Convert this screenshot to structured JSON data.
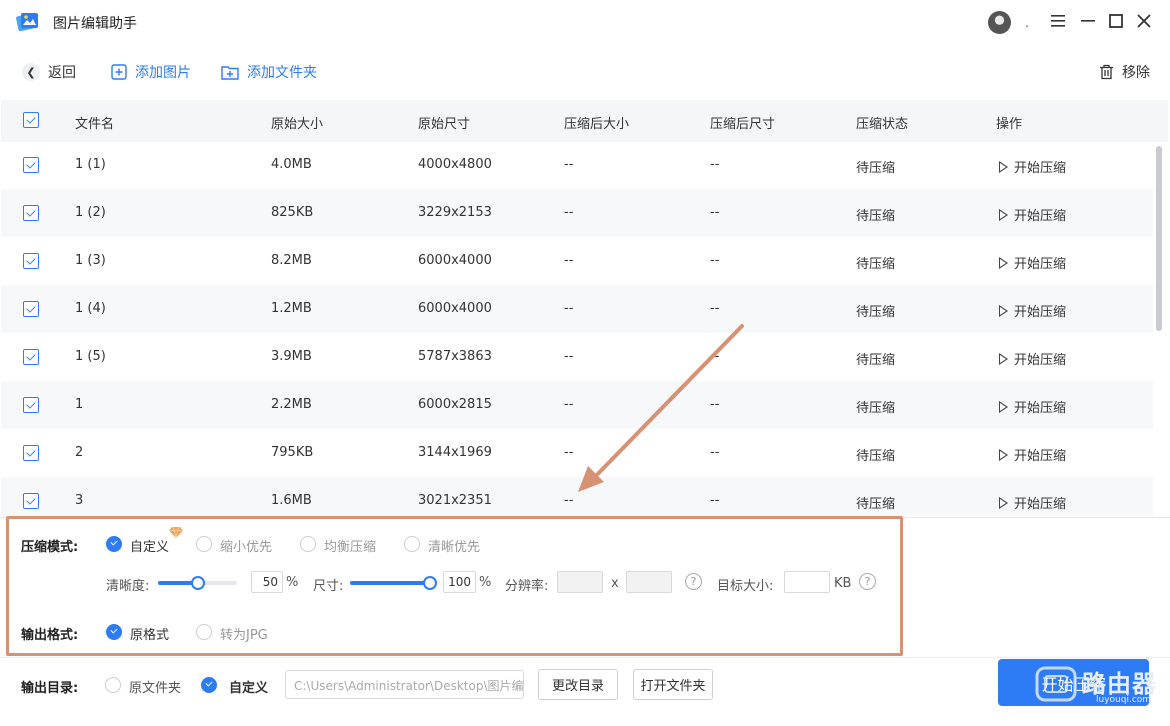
{
  "app": {
    "title": "图片编辑助手",
    "user_dot": "."
  },
  "toolbar": {
    "back_label": "返回",
    "add_image_label": "添加图片",
    "add_folder_label": "添加文件夹",
    "remove_label": "移除"
  },
  "table": {
    "headers": [
      "文件名",
      "原始大小",
      "原始尺寸",
      "压缩后大小",
      "压缩后尺寸",
      "压缩状态",
      "操作"
    ],
    "rows": [
      {
        "name": "1 (1)",
        "size": "4.0MB",
        "dims": "4000x4800",
        "after_size": "--",
        "after_dims": "--",
        "status": "待压缩",
        "action": "开始压缩"
      },
      {
        "name": "1 (2)",
        "size": "825KB",
        "dims": "3229x2153",
        "after_size": "--",
        "after_dims": "--",
        "status": "待压缩",
        "action": "开始压缩"
      },
      {
        "name": "1 (3)",
        "size": "8.2MB",
        "dims": "6000x4000",
        "after_size": "--",
        "after_dims": "--",
        "status": "待压缩",
        "action": "开始压缩"
      },
      {
        "name": "1 (4)",
        "size": "1.2MB",
        "dims": "6000x4000",
        "after_size": "--",
        "after_dims": "--",
        "status": "待压缩",
        "action": "开始压缩"
      },
      {
        "name": "1 (5)",
        "size": "3.9MB",
        "dims": "5787x3863",
        "after_size": "--",
        "after_dims": "--",
        "status": "待压缩",
        "action": "开始压缩"
      },
      {
        "name": "1",
        "size": "2.2MB",
        "dims": "6000x2815",
        "after_size": "--",
        "after_dims": "--",
        "status": "待压缩",
        "action": "开始压缩"
      },
      {
        "name": "2",
        "size": "795KB",
        "dims": "3144x1969",
        "after_size": "--",
        "after_dims": "--",
        "status": "待压缩",
        "action": "开始压缩"
      },
      {
        "name": "3",
        "size": "1.6MB",
        "dims": "3021x2351",
        "after_size": "--",
        "after_dims": "--",
        "status": "待压缩",
        "action": "开始压缩"
      }
    ]
  },
  "settings": {
    "mode_label": "压缩模式:",
    "mode_options": [
      "自定义",
      "缩小优先",
      "均衡压缩",
      "清晰优先"
    ],
    "mode_selected": "自定义",
    "clarity_label": "清晰度:",
    "clarity_value": "50",
    "clarity_level": 0.5,
    "percent": "%",
    "size_label": "尺寸:",
    "size_value": "100",
    "size_level": 1.0,
    "resolution_label": "分辨率:",
    "resolution_x": "x",
    "target_label": "目标大小:",
    "target_unit": "KB",
    "help": "?",
    "format_label": "输出格式:",
    "format_options": [
      "原格式",
      "转为JPG"
    ],
    "format_selected": "原格式"
  },
  "output": {
    "dir_label": "输出目录:",
    "dir_options": [
      "原文件夹",
      "自定义"
    ],
    "dir_selected": "自定义",
    "path_value": "C:\\Users\\Administrator\\Desktop\\图片编辑",
    "change_dir_label": "更改目录",
    "open_folder_label": "打开文件夹",
    "start_label": "开始压缩"
  },
  "watermark": {
    "text": "路由器",
    "sub": "luyouqi.com"
  },
  "colors": {
    "accent": "#2d7cf6",
    "highlight": "#d69272"
  }
}
